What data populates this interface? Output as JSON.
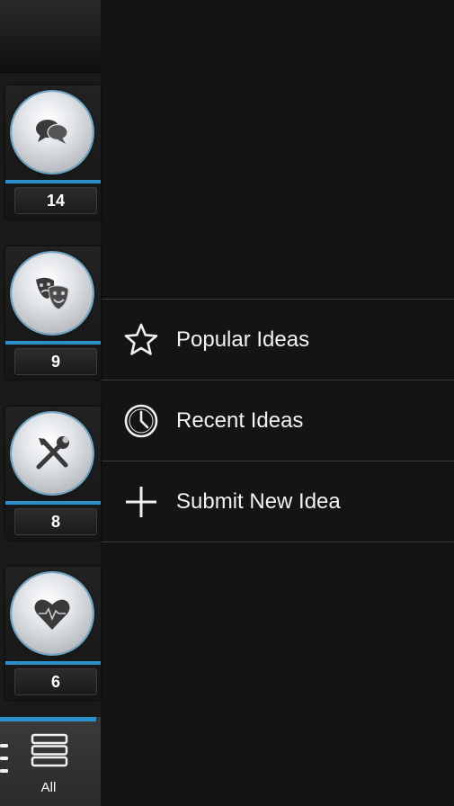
{
  "categories": [
    {
      "icon": "chat-bubbles-icon",
      "count": "14"
    },
    {
      "icon": "theater-masks-icon",
      "count": "9"
    },
    {
      "icon": "tools-icon",
      "count": "8"
    },
    {
      "icon": "heart-pulse-icon",
      "count": "6"
    }
  ],
  "all_button": {
    "label": "All",
    "icon": "list-view-icon"
  },
  "menu": {
    "items": [
      {
        "label": "Popular Ideas",
        "icon": "star-icon"
      },
      {
        "label": "Recent Ideas",
        "icon": "clock-icon"
      },
      {
        "label": "Submit New Idea",
        "icon": "plus-icon"
      }
    ]
  },
  "colors": {
    "accent": "#2c8fc9",
    "background": "#141414",
    "divider": "#3a3a3a"
  }
}
